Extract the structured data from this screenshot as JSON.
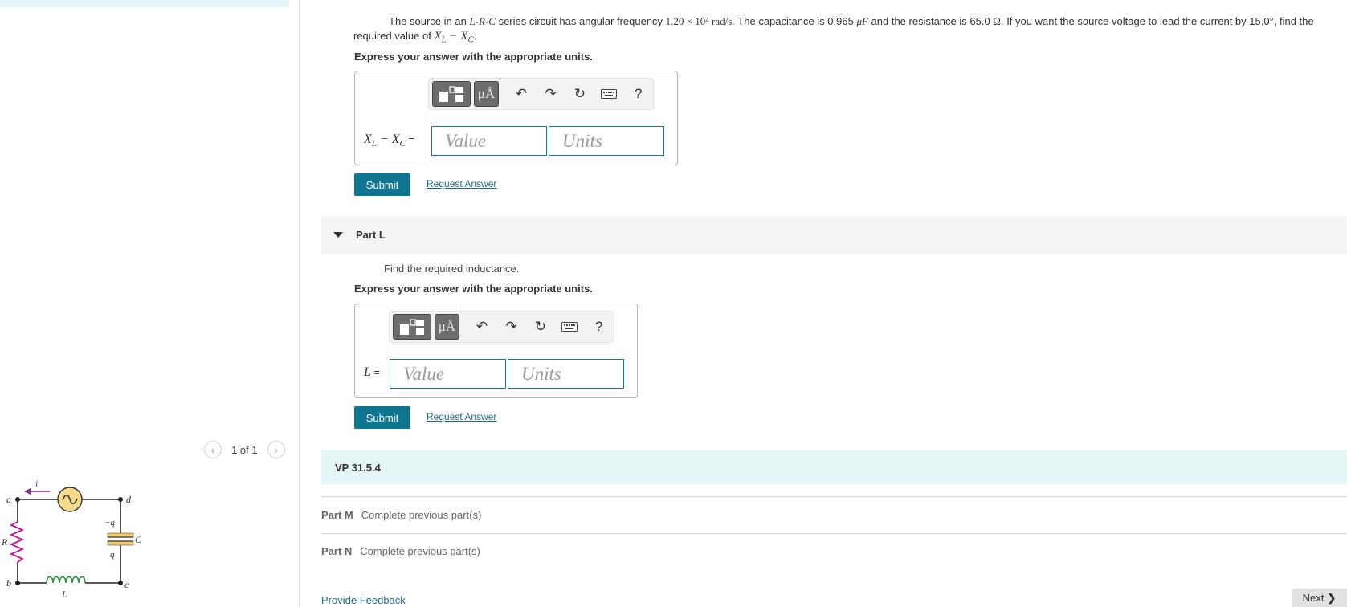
{
  "left": {
    "pager_text": "1 of 1",
    "prev_icon": "chevron-left-icon",
    "next_icon": "chevron-right-icon",
    "circuit_labels": {
      "a": "a",
      "b": "b",
      "c": "c",
      "d": "d",
      "i": "i",
      "R": "R",
      "L": "L",
      "C": "C",
      "minus_q": "−q",
      "plus_q": "q"
    }
  },
  "problem": {
    "text_1": "The source in an ",
    "math_LRC": "L-R-C",
    "text_2": " series circuit has angular frequency ",
    "math_omega": "1.20 × 10⁴ rad/s",
    "text_3": ". The capacitance is 0.965 ",
    "math_uF": "μF",
    "text_4": " and the resistance is 65.0 ",
    "math_ohm": "Ω",
    "text_5": ". If you want the source voltage to lead the current by 15.0°, find the required value of ",
    "math_target": "X",
    "math_sub_L": "L",
    "math_minus": " − X",
    "math_sub_C": "C",
    "text_6": "."
  },
  "partK": {
    "express": "Express your answer with the appropriate units.",
    "label_X": "X",
    "label_sub_L": "L",
    "label_minus": " − X",
    "label_sub_C": "C",
    "label_eq": " =",
    "value_placeholder": "Value",
    "units_placeholder": "Units",
    "submit": "Submit",
    "request": "Request Answer"
  },
  "toolbar": {
    "mu_angstrom": "μÅ",
    "help": "?",
    "icons": [
      "templates-icon",
      "units-icon",
      "undo-icon",
      "redo-icon",
      "reset-icon",
      "keyboard-icon",
      "help-icon"
    ]
  },
  "partL": {
    "title": "Part L",
    "text": "Find the required inductance.",
    "express": "Express your answer with the appropriate units.",
    "label": "L",
    "label_eq": " =",
    "value_placeholder": "Value",
    "units_placeholder": "Units",
    "submit": "Submit",
    "request": "Request Answer"
  },
  "vp": {
    "title": "VP 31.5.4"
  },
  "partM": {
    "name": "Part M",
    "status": "Complete previous part(s)"
  },
  "partN": {
    "name": "Part N",
    "status": "Complete previous part(s)"
  },
  "footer": {
    "feedback": "Provide Feedback",
    "next": "Next"
  },
  "colors": {
    "accent": "#0e7490",
    "link": "#1f6f86",
    "vp_bg": "#e6f5f5"
  }
}
